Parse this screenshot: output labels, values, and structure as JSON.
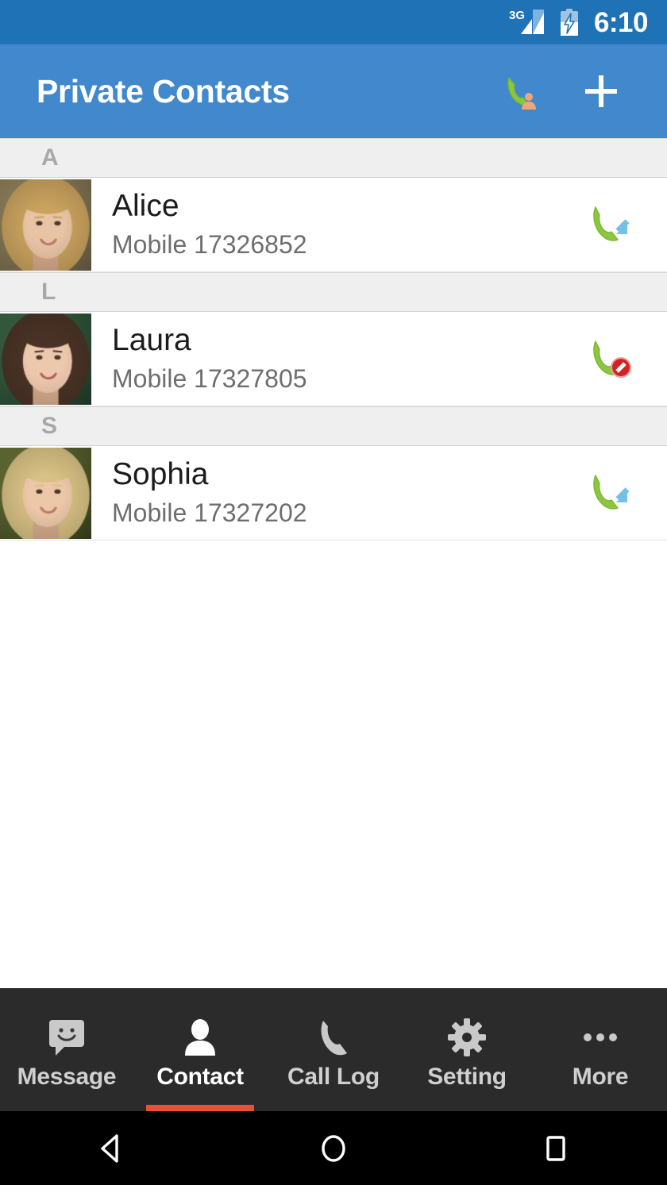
{
  "status_bar": {
    "network_label": "3G",
    "network_icon": "signal-3g-icon",
    "battery_icon": "battery-charging-icon",
    "time": "6:10",
    "background_color": "#1f72b5"
  },
  "app_bar": {
    "title": "Private Contacts",
    "background_color": "#4189cc",
    "actions": [
      {
        "name": "import-contacts-icon",
        "label": "Import contacts"
      },
      {
        "name": "add-contact-icon",
        "label": "+"
      }
    ]
  },
  "contacts": {
    "sections": [
      {
        "letter": "A",
        "items": [
          {
            "name": "Alice",
            "line_type": "Mobile",
            "number": "17326852",
            "subtitle": "Mobile 17326852",
            "call_state": "incoming",
            "call_icon": "call-incoming-icon",
            "avatar": "avatar-alice"
          }
        ]
      },
      {
        "letter": "L",
        "items": [
          {
            "name": "Laura",
            "line_type": "Mobile",
            "number": "17327805",
            "subtitle": "Mobile 17327805",
            "call_state": "blocked",
            "call_icon": "call-blocked-icon",
            "avatar": "avatar-laura"
          }
        ]
      },
      {
        "letter": "S",
        "items": [
          {
            "name": "Sophia",
            "line_type": "Mobile",
            "number": "17327202",
            "subtitle": "Mobile 17327202",
            "call_state": "incoming",
            "call_icon": "call-incoming-icon",
            "avatar": "avatar-sophia"
          }
        ]
      }
    ]
  },
  "tab_bar": {
    "background_color": "#2b2b2b",
    "active_indicator_color": "#e8503a",
    "active_index": 1,
    "tabs": [
      {
        "label": "Message",
        "icon": "message-bubble-icon"
      },
      {
        "label": "Contact",
        "icon": "person-icon"
      },
      {
        "label": "Call Log",
        "icon": "phone-handset-icon"
      },
      {
        "label": "Setting",
        "icon": "gear-icon"
      },
      {
        "label": "More",
        "icon": "ellipsis-icon"
      }
    ]
  },
  "system_nav": {
    "buttons": [
      {
        "name": "back-button",
        "icon": "triangle-back-icon"
      },
      {
        "name": "home-button",
        "icon": "circle-home-icon"
      },
      {
        "name": "recents-button",
        "icon": "square-recents-icon"
      }
    ]
  }
}
